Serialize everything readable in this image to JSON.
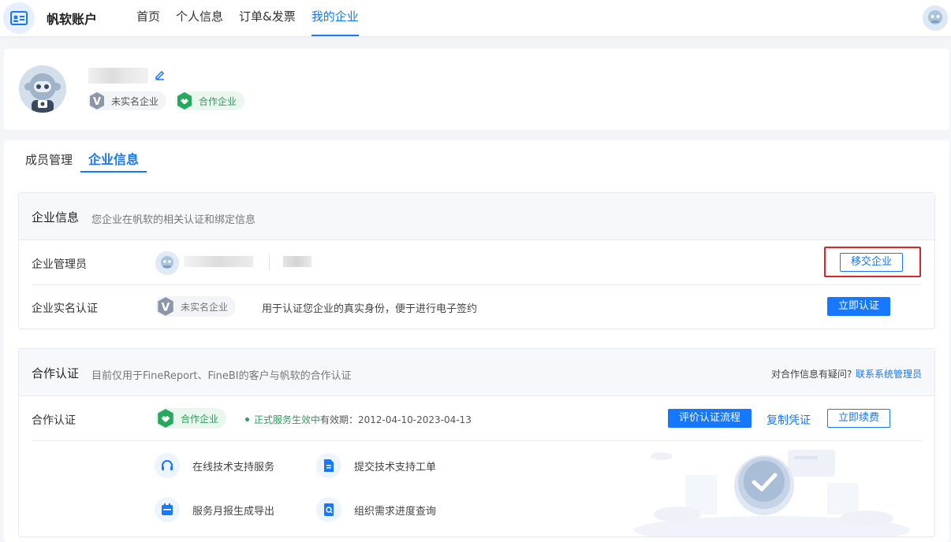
{
  "topbar": {
    "brand": "帆软账户",
    "nav": [
      "首页",
      "个人信息",
      "订单&发票",
      "我的企业"
    ]
  },
  "profile": {
    "badge_unverified": "未实名企业",
    "badge_partner": "合作企业"
  },
  "tabs": [
    "成员管理",
    "企业信息"
  ],
  "enterprise_panel": {
    "title": "企业信息",
    "desc": "您企业在帆软的相关认证和绑定信息",
    "admin_label": "企业管理员",
    "transfer_button": "移交企业",
    "realname_label": "企业实名认证",
    "realname_badge": "未实名企业",
    "realname_desc": "用于认证您企业的真实身份，便于进行电子签约",
    "verify_button": "立即认证"
  },
  "coop_panel": {
    "title": "合作认证",
    "desc": "目前仅用于FineReport、FineBI的客户与帆软的合作认证",
    "question": "对合作信息有疑问?",
    "contact_link": "联系系统管理员",
    "row_label": "合作认证",
    "badge": "合作企业",
    "status": "正式服务生效中",
    "validity": "有效期：2012-04-10-2023-04-13",
    "flow_button": "评价认证流程",
    "copy_link": "复制凭证",
    "renew_button": "立即续费",
    "services": [
      "在线技术支持服务",
      "提交技术支持工单",
      "服务月报生成导出",
      "组织需求进度查询"
    ]
  }
}
